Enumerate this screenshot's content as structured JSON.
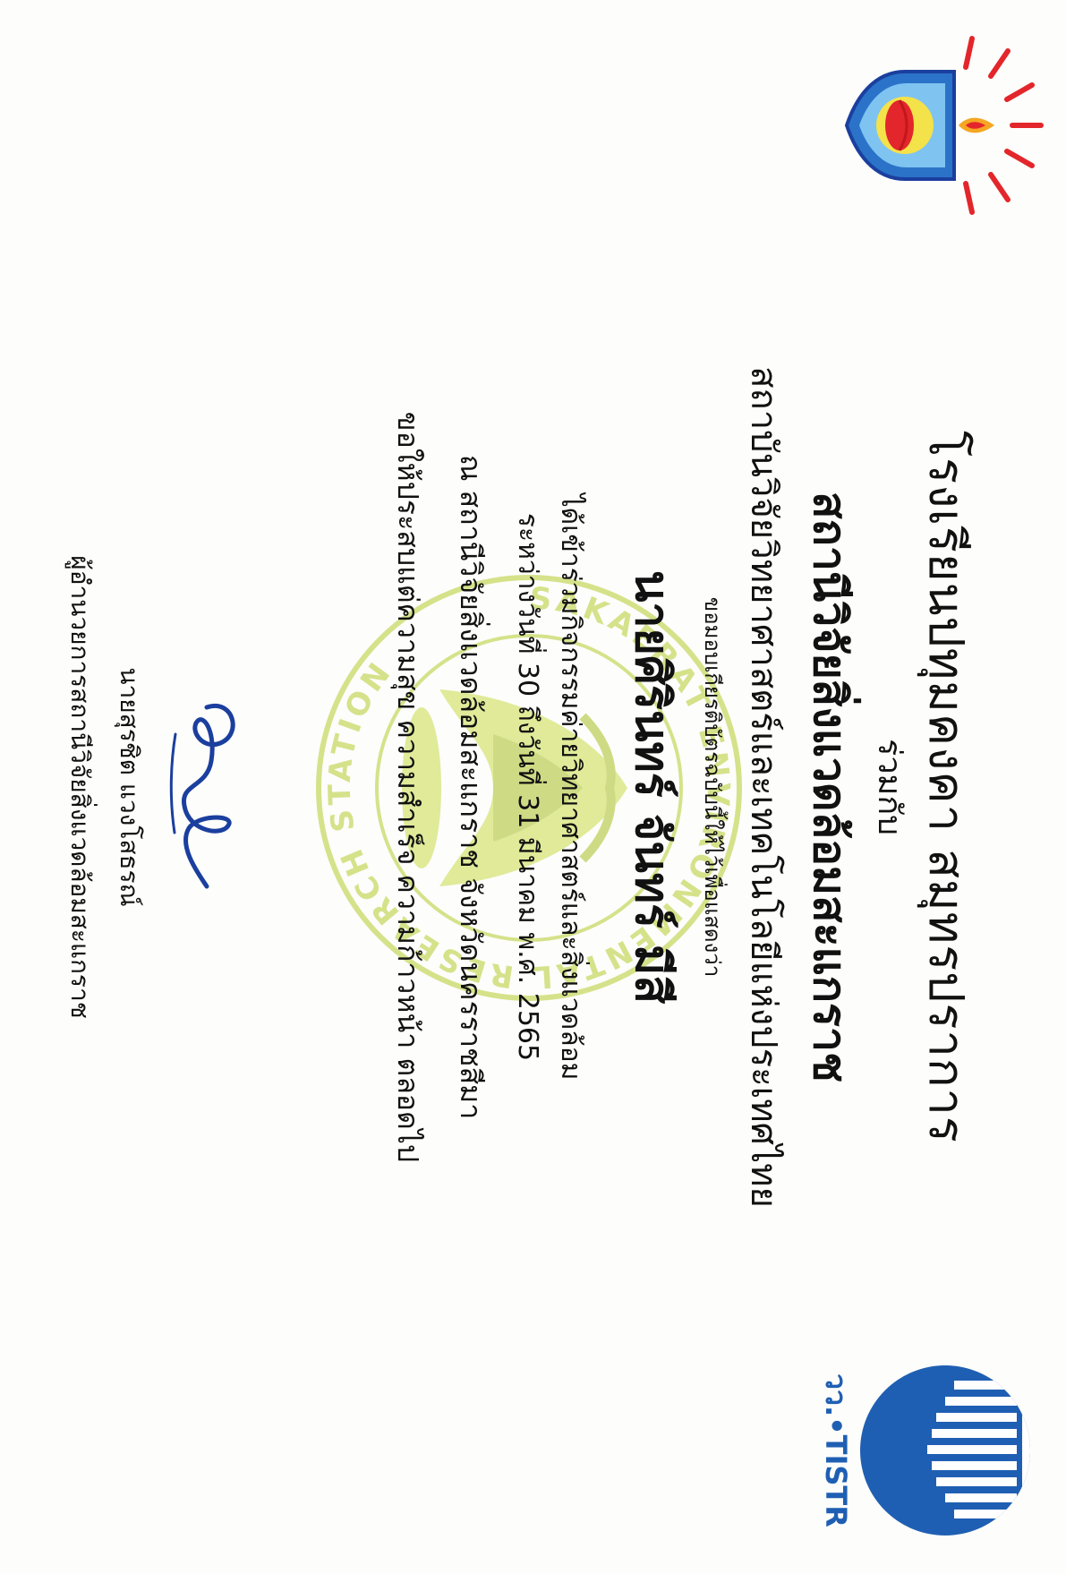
{
  "certificate": {
    "school_name": "โรงเรียนปทุมคงคา สมุทรปราการ",
    "joint_with": "ร่วมกับ",
    "station_name": "สถานีวิจัยสิ่งแวดล้อมสะแกราช",
    "institute_name": "สถาบันวิจัยวิทยาศาสตร์และเทคโนโลยีแห่งประเทศไทย",
    "certify_text": "ขอมอบเกียรติบัตรฉบับนี้ให้ไว้เพื่อแสดงว่า",
    "recipient_name": "นายศิรินทร์ จันทร์ มีสี",
    "activity_text": "ได้เข้าร่วมกิจกรรมค่ายวิทยาศาสตร์และสิ่งแวดล้อม",
    "dates_text": "ระหว่างวันที่ 30 ถึงวันที่ 31 มีนาคม พ.ศ. 2565",
    "location_text": "ณ สถานีวิจัยสิ่งแวดล้อมสะแกราช จังหวัดนครราชสีมา",
    "wish_text": "ขอให้ประสบแต่ความสุข ความสำเร็จ ความก้าวหน้า ตลอดไป",
    "signer_name": "นายสุรชิต แวงโสธรณ์",
    "signer_position": "ผู้อำนวยการสถานีวิจัยสิ่งแวดล้อมสะแกราช"
  },
  "logos": {
    "left": "school-emblem-icon",
    "right": "tistr-logo-icon",
    "right_label": "วว.•TISTR",
    "watermark": "sakaerat-station-seal-icon",
    "watermark_text": "SAKAERAT ENVIRONMENTAL RESEARCH STATION"
  },
  "colors": {
    "text": "#111111",
    "watermark": "#b5cc2e",
    "tistr_blue": "#1f5fb3",
    "signature_ink": "#1b3f9e",
    "emblem_red": "#e3262b",
    "emblem_blue": "#2a73c9"
  }
}
